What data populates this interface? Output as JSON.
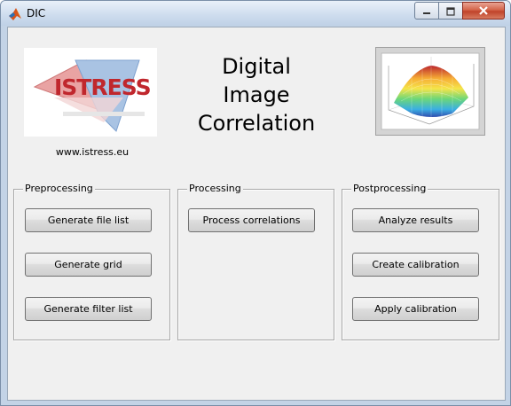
{
  "window": {
    "title": "DIC"
  },
  "header": {
    "logo_text": "ISTRESS",
    "website": "www.istress.eu",
    "heading_lines": [
      "Digital",
      "Image",
      "Correlation"
    ]
  },
  "panels": {
    "preprocessing": {
      "title": "Preprocessing",
      "buttons": [
        "Generate file list",
        "Generate grid",
        "Generate filter list"
      ]
    },
    "processing": {
      "title": "Processing",
      "buttons": [
        "Process correlations"
      ]
    },
    "postprocessing": {
      "title": "Postprocessing",
      "buttons": [
        "Analyze results",
        "Create calibration",
        "Apply calibration"
      ]
    }
  },
  "colors": {
    "logo_red": "#c0272d",
    "logo_blue": "#2b5fa8",
    "close_red": "#c0432a"
  },
  "icons": [
    "matlab-icon",
    "minimize-icon",
    "maximize-icon",
    "close-icon"
  ]
}
